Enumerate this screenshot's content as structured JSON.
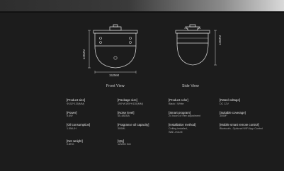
{
  "front_view": {
    "caption": "Front View",
    "width_label": "152MM",
    "height_label": "135MM"
  },
  "side_view": {
    "caption": "Side View",
    "height_label": "135MM"
  },
  "specs": [
    {
      "label": "[Product size]",
      "value": "Φ152*135(MM)"
    },
    {
      "label": "[Package size]",
      "value": "190*W195*H135(MM)"
    },
    {
      "label": "[Product color]",
      "value": "Black / White"
    },
    {
      "label": "[Rated voltage]",
      "value": "DC 12V"
    },
    {
      "label": "[Power]",
      "value": "5.6W"
    },
    {
      "label": "[Noise level]",
      "value": "45-48DBA"
    },
    {
      "label": "[Smart program]",
      "value": "24 hours of free adjustment"
    },
    {
      "label": "[Suitable coverage]",
      "value": "300M³"
    },
    {
      "label": "[Oil consumption]",
      "value": "1.5ML/H"
    },
    {
      "label": "[Fragrance oil capacity]",
      "value": "300ML"
    },
    {
      "label": "[Installation method]",
      "value": "Ceiling installed,\nWall -mount"
    },
    {
      "label": "[Mobile smart remote control]",
      "value": "Bluetooth , Optional WiFi App Control"
    },
    {
      "label": "[Net weight]",
      "value": "0.8KG"
    },
    {
      "label": "[Qty]",
      "value": "12sets/ box"
    }
  ]
}
